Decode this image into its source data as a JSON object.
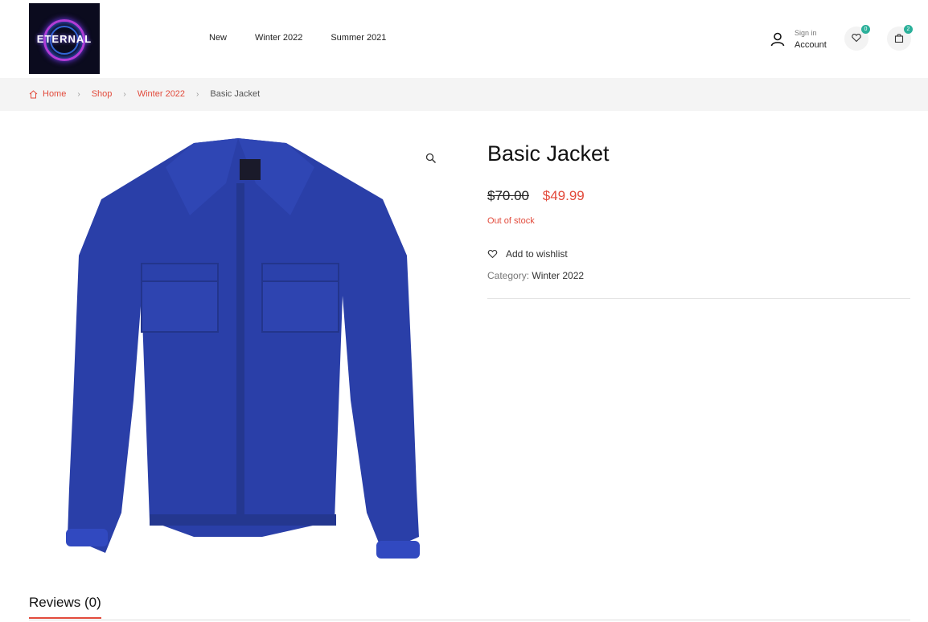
{
  "brand": {
    "logo_text": "ETERNAL"
  },
  "nav": {
    "items": [
      "New",
      "Winter 2022",
      "Summer 2021"
    ]
  },
  "account": {
    "sign_in": "Sign in",
    "label": "Account"
  },
  "wishlist": {
    "count": "0"
  },
  "cart": {
    "count": "2"
  },
  "breadcrumb": {
    "home": "Home",
    "shop": "Shop",
    "category": "Winter 2022",
    "current": "Basic Jacket"
  },
  "product": {
    "title": "Basic Jacket",
    "old_price": "$70.00",
    "new_price": "$49.99",
    "stock": "Out of stock",
    "wishlist_label": "Add to wishlist",
    "category_label": "Category:",
    "category_value": "Winter 2022",
    "image_color": "#2a3fa8"
  },
  "tabs": {
    "reviews": "Reviews (0)"
  },
  "colors": {
    "accent": "#e24a3b",
    "badge": "#2bb09a"
  }
}
